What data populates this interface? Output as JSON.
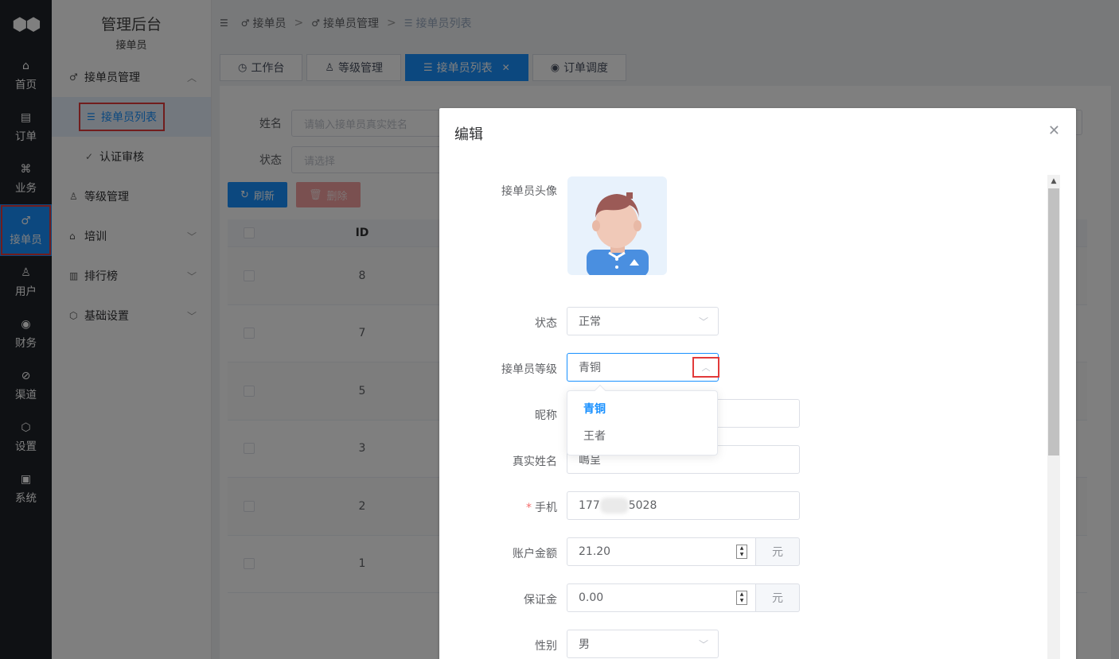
{
  "rail": {
    "items": [
      {
        "label": "首页",
        "icon": "home-icon"
      },
      {
        "label": "订单",
        "icon": "order-icon"
      },
      {
        "label": "业务",
        "icon": "business-icon"
      },
      {
        "label": "接单员",
        "icon": "bike-icon"
      },
      {
        "label": "用户",
        "icon": "user-icon"
      },
      {
        "label": "财务",
        "icon": "finance-icon"
      },
      {
        "label": "渠道",
        "icon": "channel-icon"
      },
      {
        "label": "设置",
        "icon": "settings-icon"
      },
      {
        "label": "系统",
        "icon": "system-icon"
      }
    ],
    "active_index": 3
  },
  "sidebar": {
    "title": "管理后台",
    "subtitle": "接单员",
    "groups": [
      {
        "label": "接单员管理",
        "icon": "bike-icon"
      },
      {
        "label": "等级管理",
        "icon": "users-icon"
      },
      {
        "label": "培训",
        "icon": "training-icon"
      },
      {
        "label": "排行榜",
        "icon": "ranking-icon"
      },
      {
        "label": "基础设置",
        "icon": "gear-icon"
      }
    ],
    "sub_items": [
      {
        "label": "接单员列表",
        "icon": "list-icon"
      },
      {
        "label": "认证审核",
        "icon": "check-circle-icon"
      }
    ]
  },
  "breadcrumb": {
    "items": [
      "接单员",
      "接单员管理",
      "接单员列表"
    ],
    "separator": ">"
  },
  "tabs": [
    {
      "label": "工作台"
    },
    {
      "label": "等级管理"
    },
    {
      "label": "接单员列表",
      "closable": true
    },
    {
      "label": "订单调度"
    }
  ],
  "filters": {
    "name_label": "姓名",
    "name_placeholder": "请输入接单员真实姓名",
    "status_label": "状态",
    "status_placeholder": "请选择"
  },
  "toolbar": {
    "refresh_label": "刷新",
    "delete_label": "删除"
  },
  "table": {
    "header_id": "ID",
    "ids": [
      "8",
      "7",
      "5",
      "3",
      "2",
      "1"
    ]
  },
  "dialog": {
    "title": "编辑",
    "avatar_label": "接单员头像",
    "status_label": "状态",
    "status_value": "正常",
    "level_label": "接单员等级",
    "level_value": "青铜",
    "level_options": [
      "青铜",
      "王者"
    ],
    "nickname_label": "昵称",
    "nickname_value": "",
    "realname_label": "真实姓名",
    "realname_value": "嶋呈",
    "phone_label": "手机",
    "phone_prefix": "177",
    "phone_suffix": "5028",
    "balance_label": "账户金额",
    "balance_value": "21.20",
    "balance_unit": "元",
    "deposit_label": "保证金",
    "deposit_value": "0.00",
    "deposit_unit": "元",
    "gender_label": "性别",
    "gender_value": "男"
  },
  "colors": {
    "primary": "#1890ff",
    "rail_bg": "#1f2329",
    "highlight": "#e23a3a"
  }
}
